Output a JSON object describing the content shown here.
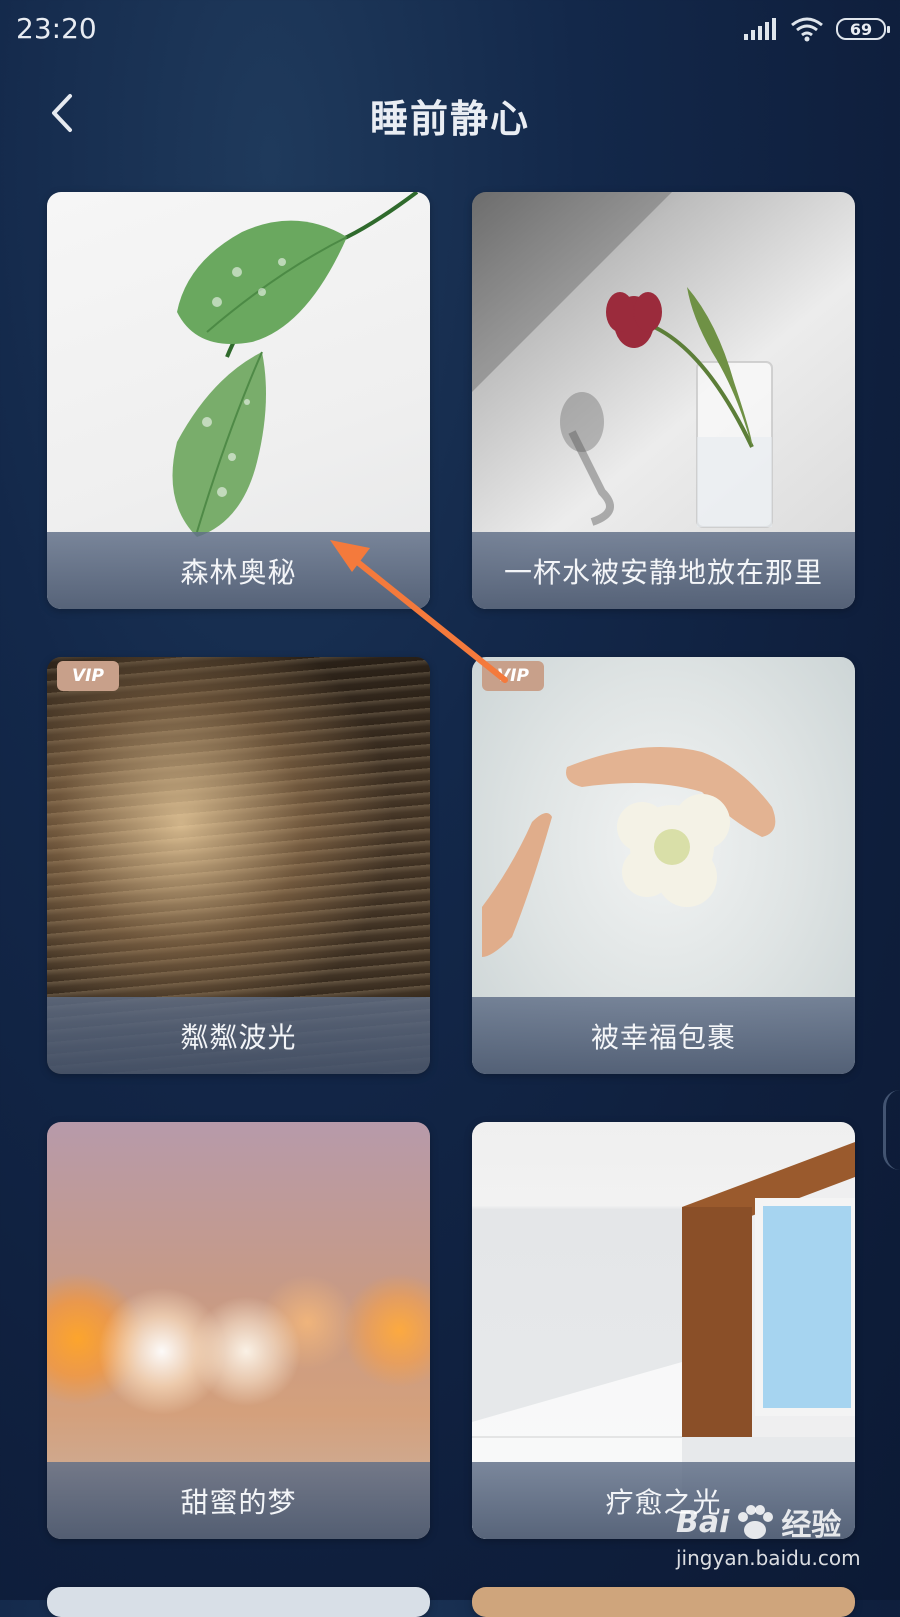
{
  "status_bar": {
    "time": "23:20",
    "battery": "69"
  },
  "header": {
    "title": "睡前静心"
  },
  "cards": [
    {
      "title": "森林奥秘",
      "vip": false
    },
    {
      "title": "一杯水被安静地放在那里",
      "vip": false
    },
    {
      "title": "粼粼波光",
      "vip": true,
      "badge": "VIP"
    },
    {
      "title": "被幸福包裹",
      "vip": true,
      "badge": "VIP"
    },
    {
      "title": "甜蜜的梦",
      "vip": false
    },
    {
      "title": "疗愈之光",
      "vip": false
    }
  ],
  "colors": {
    "background": "#13284a",
    "caption_bar": "#5f6e87",
    "vip_badge": "#c8a08a",
    "annotation_arrow": "#f47a3c"
  },
  "watermark": {
    "brand": "Bai",
    "brand_suffix": "经验",
    "url": "jingyan.baidu.com"
  }
}
